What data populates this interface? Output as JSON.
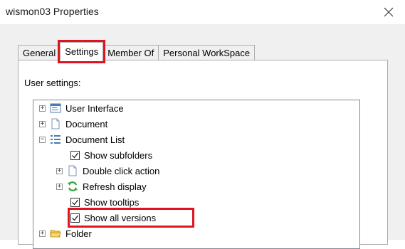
{
  "window": {
    "title": "wismon03 Properties"
  },
  "tabs": [
    {
      "label": "General"
    },
    {
      "label": "Settings"
    },
    {
      "label": "Member Of"
    },
    {
      "label": "Personal WorkSpace"
    }
  ],
  "panel": {
    "label": "User settings:"
  },
  "tree": {
    "items": [
      {
        "label": "User Interface"
      },
      {
        "label": "Document"
      },
      {
        "label": "Document List"
      },
      {
        "label": "Show subfolders"
      },
      {
        "label": "Double click action"
      },
      {
        "label": "Refresh display"
      },
      {
        "label": "Show tooltips"
      },
      {
        "label": "Show all versions"
      },
      {
        "label": "Folder"
      }
    ]
  },
  "colors": {
    "highlight": "#e0141e"
  }
}
